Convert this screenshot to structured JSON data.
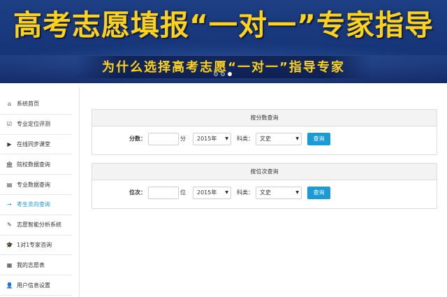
{
  "banner": {
    "title": "高考志愿填报“一对一”专家指导",
    "subtitle": "为什么选择高考志愿“一对一”指导专家",
    "carousel_dots": 3,
    "active_dot": 2
  },
  "sidebar": {
    "items": [
      {
        "label": "系统首页",
        "icon": "home-icon",
        "glyph": "⌂"
      },
      {
        "label": "专业定位评测",
        "icon": "checkbox-icon",
        "glyph": "☑"
      },
      {
        "label": "在线同步课堂",
        "icon": "video-icon",
        "glyph": "▶"
      },
      {
        "label": "院校数据查询",
        "icon": "institution-icon",
        "glyph": "🏛"
      },
      {
        "label": "专业数据查询",
        "icon": "book-icon",
        "glyph": "▤"
      },
      {
        "label": "考生去向查询",
        "icon": "arrow-right-icon",
        "glyph": "→"
      },
      {
        "label": "志愿智能分析系统",
        "icon": "edit-icon",
        "glyph": "✎"
      },
      {
        "label": "1对1专家咨询",
        "icon": "graduation-cap-icon",
        "glyph": "🎓"
      },
      {
        "label": "我的志愿表",
        "icon": "table-icon",
        "glyph": "▦"
      },
      {
        "label": "用户信息设置",
        "icon": "user-icon",
        "glyph": "👤"
      }
    ],
    "active_index": 5,
    "active_color": "#1a9ad7"
  },
  "score_query": {
    "header": "按分数查询",
    "field_label": "分数：",
    "field_value": "",
    "unit": "分",
    "year": "2015年",
    "subject_label": "科类：",
    "subject": "文史",
    "button": "查询"
  },
  "rank_query": {
    "header": "按位次查询",
    "field_label": "位次：",
    "field_value": "",
    "unit": "位",
    "year": "2015年",
    "subject_label": "科类：",
    "subject": "文史",
    "button": "查询"
  },
  "colors": {
    "accent": "#1a9ad7",
    "banner_text": "#ffd21a",
    "banner_bg": "#1a3a7e"
  }
}
